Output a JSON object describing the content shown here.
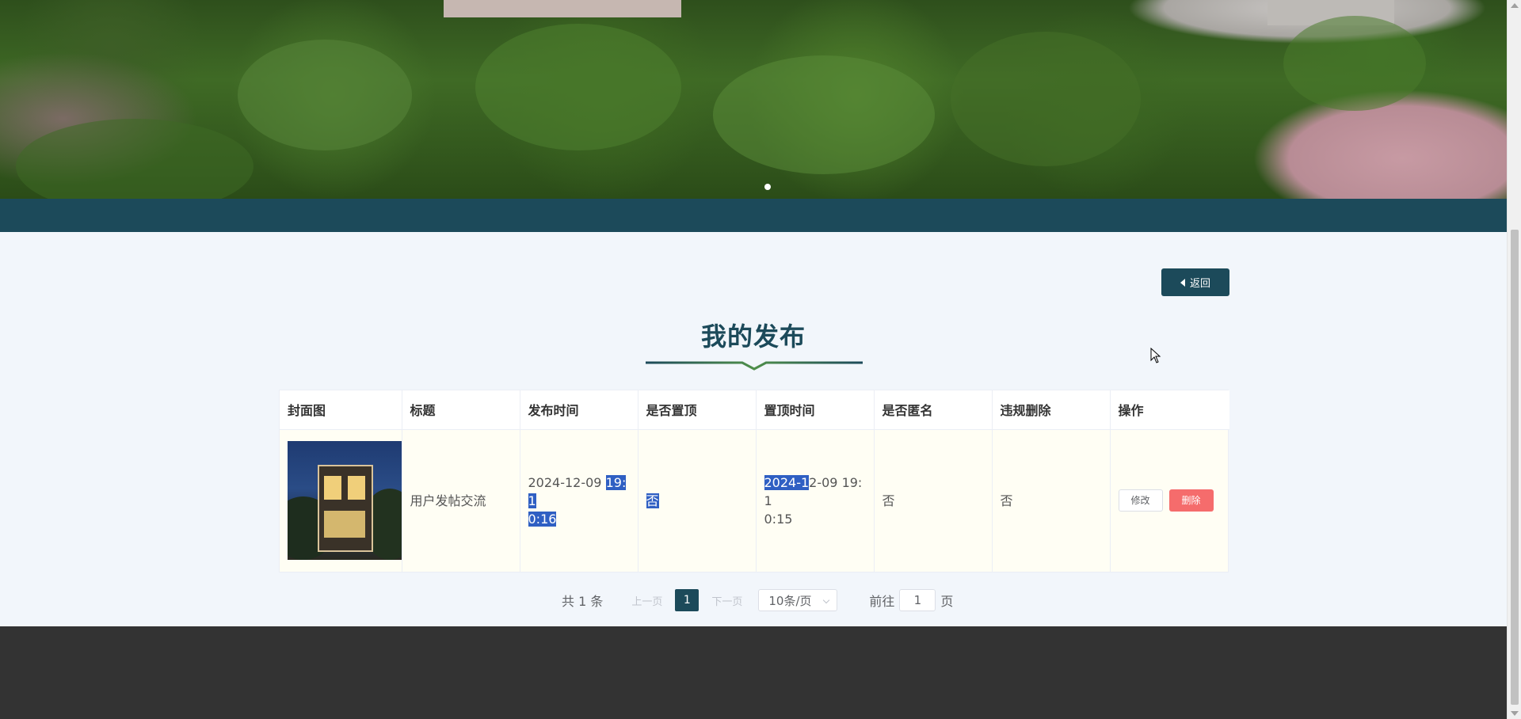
{
  "header_nav": {
    "back_label": "返回"
  },
  "page": {
    "title": "我的发布"
  },
  "table": {
    "columns": [
      "封面图",
      "标题",
      "发布时间",
      "是否置顶",
      "置顶时间",
      "是否匿名",
      "违规删除",
      "操作"
    ],
    "rows": [
      {
        "cover": "house-photo",
        "title": "用户发帖交流",
        "publish_time_a": "2024-12-09 ",
        "publish_time_b": "19:1",
        "publish_time_c": "0:16",
        "pinned": "否",
        "pin_time_a": "2024-1",
        "pin_time_b": "2-09 19:1",
        "pin_time_c": "0:15",
        "anonymous": "否",
        "violation_deleted": "否",
        "edit_label": "修改",
        "delete_label": "删除"
      }
    ]
  },
  "pagination": {
    "total_text": "共 1 条",
    "prev_label": "上一页",
    "current_page": "1",
    "next_label": "下一页",
    "page_size": "10条/页",
    "goto_label": "前往",
    "goto_value": "1",
    "page_suffix": "页"
  },
  "colors": {
    "primary": "#1c4a5a",
    "danger": "#f56c6c",
    "footer": "#333333"
  }
}
